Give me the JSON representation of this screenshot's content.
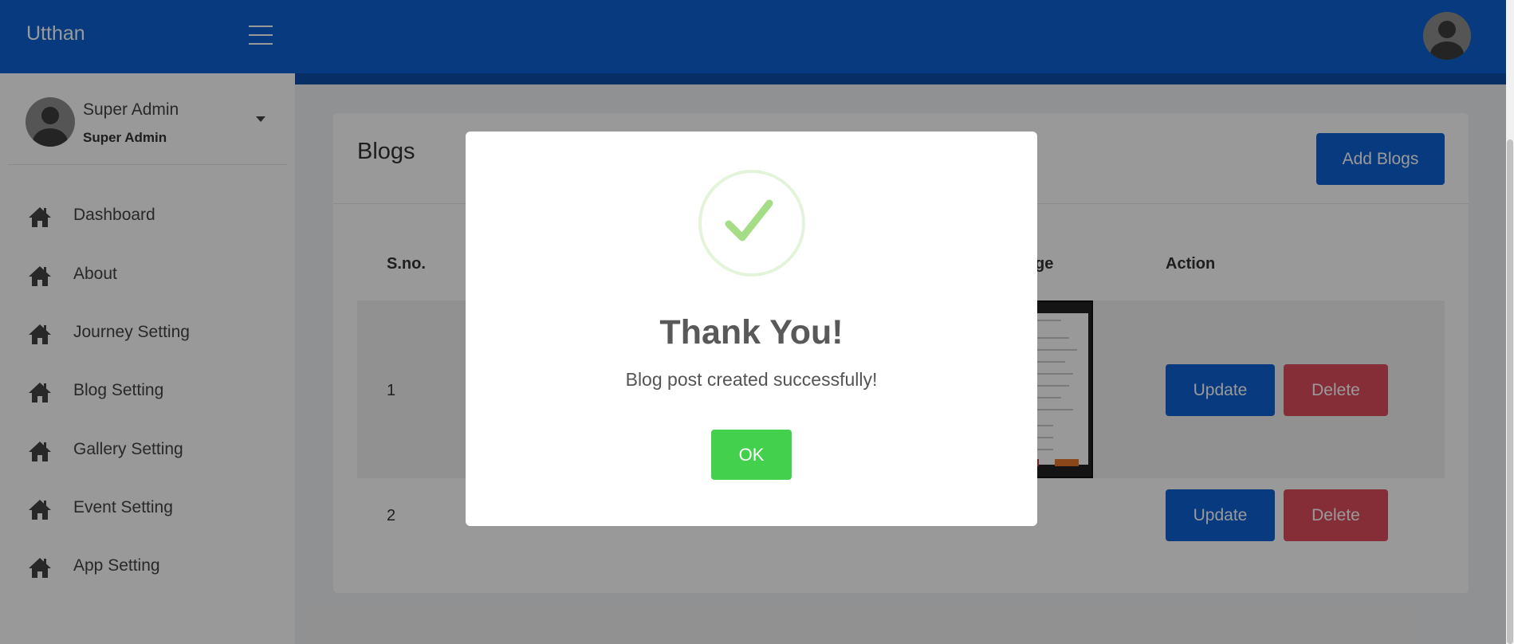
{
  "app": {
    "name": "Utthan"
  },
  "user": {
    "name": "Super Admin",
    "role": "Super Admin"
  },
  "sidebar": {
    "items": [
      {
        "label": "Dashboard"
      },
      {
        "label": "About"
      },
      {
        "label": "Journey Setting"
      },
      {
        "label": "Blog Setting"
      },
      {
        "label": "Gallery Setting"
      },
      {
        "label": "Event Setting"
      },
      {
        "label": "App Setting"
      }
    ]
  },
  "page": {
    "title": "Blogs",
    "add_button": "Add Blogs",
    "columns": {
      "sno": "S.no.",
      "image": "ge",
      "action": "Action"
    },
    "rows": [
      {
        "sno": "1",
        "update": "Update",
        "delete": "Delete"
      },
      {
        "sno": "2",
        "update": "Update",
        "delete": "Delete"
      }
    ]
  },
  "modal": {
    "title": "Thank You!",
    "message": "Blog post created successfully!",
    "ok": "OK"
  },
  "colors": {
    "primary": "#0d61d3",
    "danger": "#e04e5e",
    "success": "#43d04d",
    "check": "#a5dc86"
  },
  "icons": {
    "menu": "hamburger-icon",
    "nav": "home-icon",
    "avatar": "user-avatar-icon",
    "success": "check-icon"
  }
}
